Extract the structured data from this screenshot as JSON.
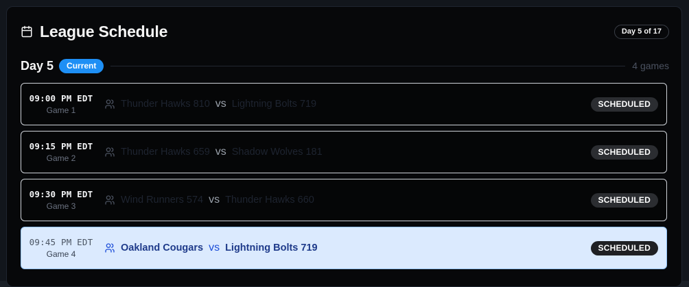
{
  "header": {
    "title": "League Schedule",
    "day_pill": "Day 5 of 17"
  },
  "day": {
    "label": "Day 5",
    "badge": "Current",
    "games_count": "4 games"
  },
  "games": [
    {
      "time": "09:00 PM EDT",
      "number": "Game 1",
      "home": "Thunder Hawks 810",
      "vs": "vs",
      "away": "Lightning Bolts 719",
      "status": "SCHEDULED"
    },
    {
      "time": "09:15 PM EDT",
      "number": "Game 2",
      "home": "Thunder Hawks 659",
      "vs": "vs",
      "away": "Shadow Wolves 181",
      "status": "SCHEDULED"
    },
    {
      "time": "09:30 PM EDT",
      "number": "Game 3",
      "home": "Wind Runners 574",
      "vs": "vs",
      "away": "Thunder Hawks 660",
      "status": "SCHEDULED"
    },
    {
      "time": "09:45 PM EDT",
      "number": "Game 4",
      "home": "Oakland Cougars",
      "vs": "vs",
      "away": "Lightning Bolts 719",
      "status": "SCHEDULED"
    }
  ],
  "colors": {
    "accent": "#1e8ff5",
    "active_row": "#dbeafe",
    "status_badge": "#2b2d31"
  },
  "icons": {
    "title": "calendar-icon",
    "team": "users-icon"
  }
}
